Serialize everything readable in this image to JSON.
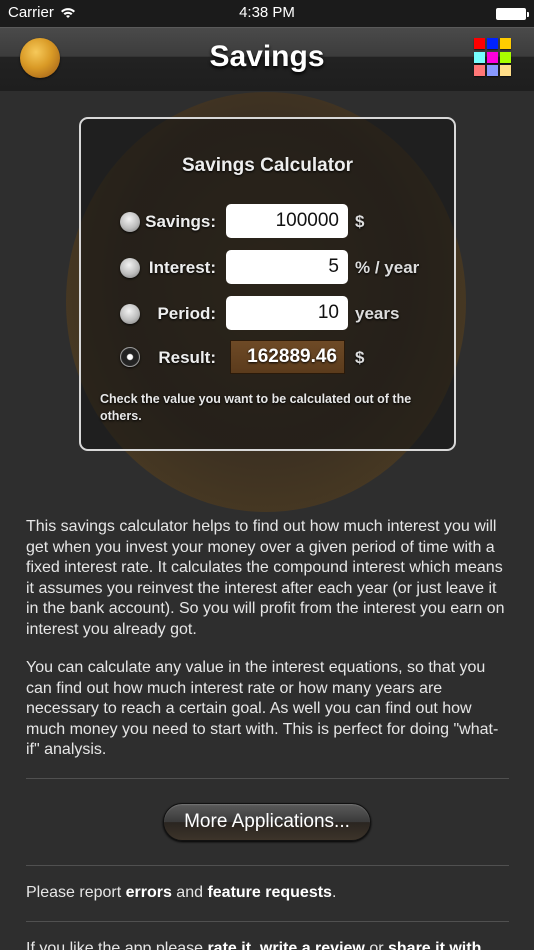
{
  "status_bar": {
    "carrier": "Carrier",
    "time": "4:38 PM"
  },
  "nav": {
    "title": "Savings",
    "left_icon": "gold-coin-icon",
    "right_icon": "apps-grid-icon",
    "grid_colors": [
      "#ff0000",
      "#0022ff",
      "#ffcc00",
      "#77ffff",
      "#ff00dd",
      "#aaff00",
      "#ff7777",
      "#8899ff",
      "#ffdd88"
    ]
  },
  "calculator": {
    "title": "Savings Calculator",
    "rows": [
      {
        "label": "Savings:",
        "value": "100000",
        "unit": "$",
        "selected": false
      },
      {
        "label": "Interest:",
        "value": "5",
        "unit": "% / year",
        "selected": false
      },
      {
        "label": "Period:",
        "value": "10",
        "unit": "years",
        "selected": false
      },
      {
        "label": "Result:",
        "value": "162889.46",
        "unit": "$",
        "selected": true
      }
    ],
    "hint": "Check the value you want to be calculated out of the others."
  },
  "description": {
    "paragraph1": "This savings calculator helps to find out how much interest you will get when you invest your money over a given period of time with a fixed interest rate. It calculates the compound interest which means it assumes you reinvest the interest after each year (or just leave it in the bank account). So you will profit from the interest you earn on interest you already got.",
    "paragraph2": "You can calculate any value in the interest equations, so that you can find out how much interest rate or how many years are necessary to reach a certain goal. As well you can find out how much money you need to start with. This is perfect for doing \"what-if\" analysis."
  },
  "more_button": "More Applications...",
  "report": {
    "prefix": "Please report ",
    "link1": "errors",
    "middle": " and ",
    "link2": "feature requests",
    "suffix": "."
  },
  "like": {
    "prefix": "If you like the app please ",
    "link1": "rate it",
    "sep1": ", ",
    "link2": "write a review",
    "sep2": " or ",
    "link3": "share it with"
  }
}
